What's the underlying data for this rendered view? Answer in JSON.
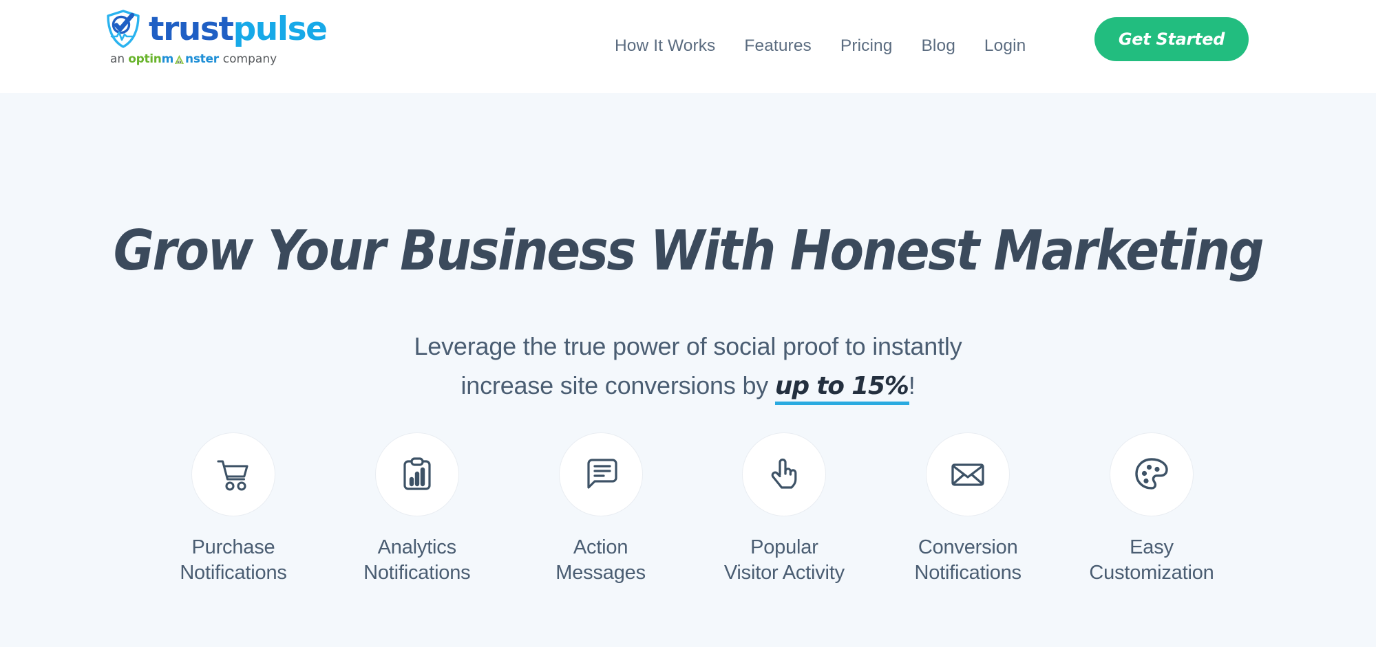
{
  "header": {
    "logo": {
      "shield_icon": "trustpulse-shield-check-pulse-icon",
      "wordmark_first": "trust",
      "wordmark_second": "pulse",
      "tagline_prefix": "an",
      "tagline_brand_green": "optin",
      "tagline_brand_m": "m",
      "tagline_monster_icon": "optinmonster-mascot-icon",
      "tagline_brand_rest": "nster",
      "tagline_suffix": "company"
    },
    "nav": [
      {
        "label": "How It Works",
        "name": "nav-link-how-it-works"
      },
      {
        "label": "Features",
        "name": "nav-link-features"
      },
      {
        "label": "Pricing",
        "name": "nav-link-pricing"
      },
      {
        "label": "Blog",
        "name": "nav-link-blog"
      },
      {
        "label": "Login",
        "name": "nav-link-login"
      }
    ],
    "cta_label": "Get Started"
  },
  "hero": {
    "title": "Grow Your Business With Honest Marketing",
    "subtitle_line1": "Leverage the true power of social proof to instantly",
    "subtitle_line2_prefix": "increase site conversions by ",
    "subtitle_highlight": "up to 15%",
    "subtitle_suffix": "!",
    "features": [
      {
        "icon": "shopping-cart-icon",
        "label": "Purchase\nNotifications"
      },
      {
        "icon": "clipboard-chart-icon",
        "label": "Analytics\nNotifications"
      },
      {
        "icon": "speech-bubble-icon",
        "label": "Action\nMessages"
      },
      {
        "icon": "pointing-hand-icon",
        "label": "Popular\nVisitor Activity"
      },
      {
        "icon": "envelope-icon",
        "label": "Conversion\nNotifications"
      },
      {
        "icon": "paint-palette-icon",
        "label": "Easy\nCustomization"
      }
    ]
  },
  "colors": {
    "header_bg": "#ffffff",
    "hero_bg": "#f4f8fc",
    "cta_green": "#22bd7f",
    "heading_slate": "#3b4a5c",
    "body_slate": "#4a5d72",
    "icon_slate": "#3d5266",
    "logo_blue": "#1f5fc4",
    "logo_cyan": "#17a9e8",
    "underline_blue": "#2aaae0",
    "optin_green": "#69b42d",
    "monster_blue": "#1f8fd6",
    "circle_border": "#e9edf2"
  }
}
